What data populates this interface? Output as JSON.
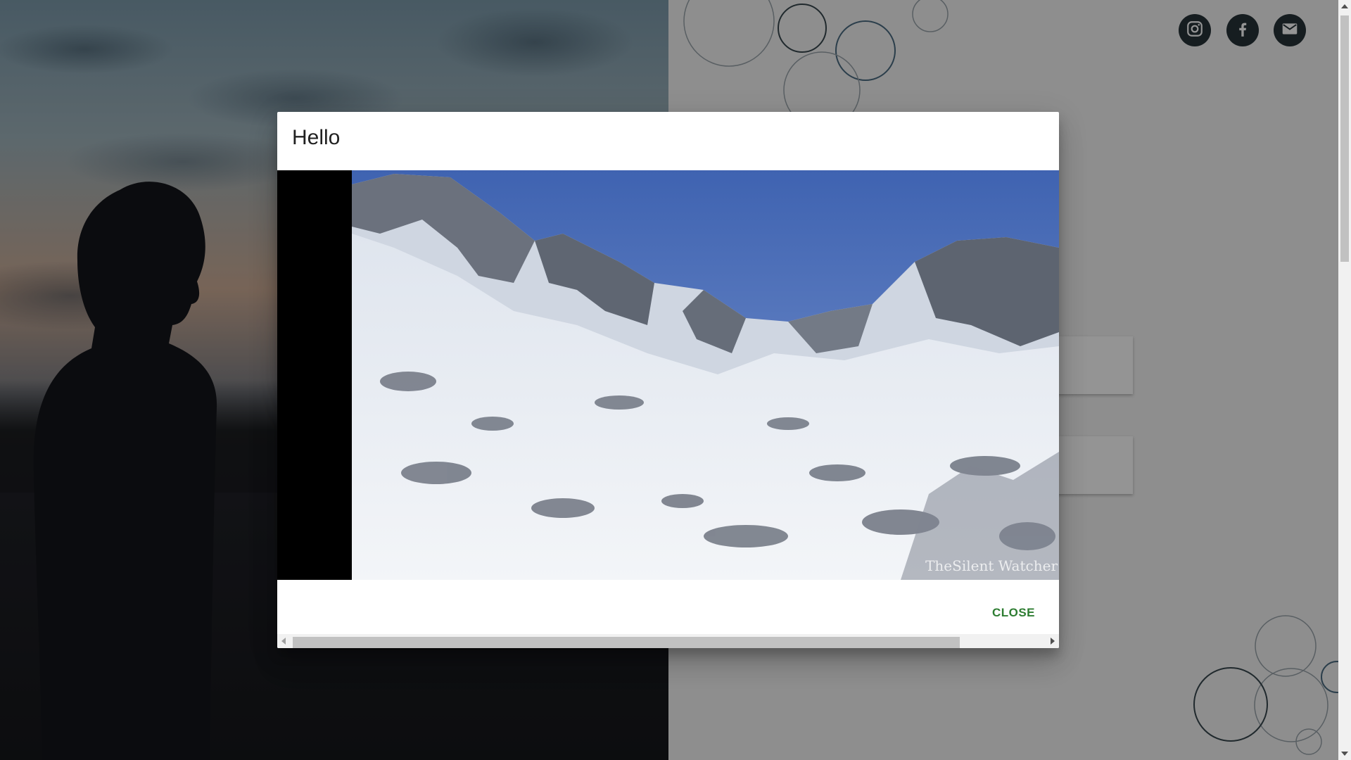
{
  "modal": {
    "title": "Hello",
    "close_label": "CLOSE",
    "video_watermark": "TheSilent Watcher"
  },
  "social": [
    {
      "name": "instagram",
      "icon": "instagram-icon"
    },
    {
      "name": "facebook",
      "icon": "facebook-icon"
    },
    {
      "name": "email",
      "icon": "mail-icon"
    }
  ],
  "colors": {
    "accent": "#2e7d32",
    "social_bg": "#263238",
    "backdrop": "rgba(0,0,0,0.42)"
  }
}
